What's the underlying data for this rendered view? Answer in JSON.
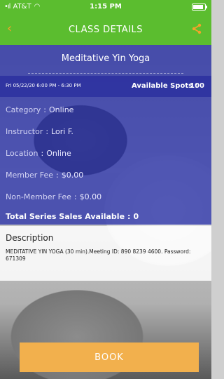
{
  "status": {
    "carrier": "AT&T",
    "time": "1:15 PM"
  },
  "nav": {
    "title": "CLASS DETAILS",
    "back_icon": "chevron-left-icon",
    "share_icon": "share-icon"
  },
  "class": {
    "name": "Meditative Yin Yoga",
    "datetime": "Fri 05/22/20 6:00 PM - 6:30 PM",
    "available_spots_label": "Available Spots :",
    "available_spots_value": "100"
  },
  "details": [
    {
      "label": "Category",
      "sep": ":",
      "value": "Online"
    },
    {
      "label": "Instructor",
      "sep": ":",
      "value": "Lori F."
    },
    {
      "label": "Location",
      "sep": ":",
      "value": "Online"
    },
    {
      "label": "Member Fee",
      "sep": ":",
      "value": "$0.00"
    },
    {
      "label": "Non-Member Fee",
      "sep": ":",
      "value": "$0.00"
    }
  ],
  "total": {
    "label": "Total Series Sales Available",
    "sep": ":",
    "value": "0"
  },
  "description": {
    "title": "Description",
    "body": "MEDITATIVE YIN YOGA  (30 min).Meeting ID: 890 8239 4600. Password: 671309"
  },
  "actions": {
    "book_label": "BOOK"
  },
  "colors": {
    "header_green": "#5bbd2f",
    "panel_blue": "#3138aa",
    "accent_orange": "#f2b04d"
  }
}
